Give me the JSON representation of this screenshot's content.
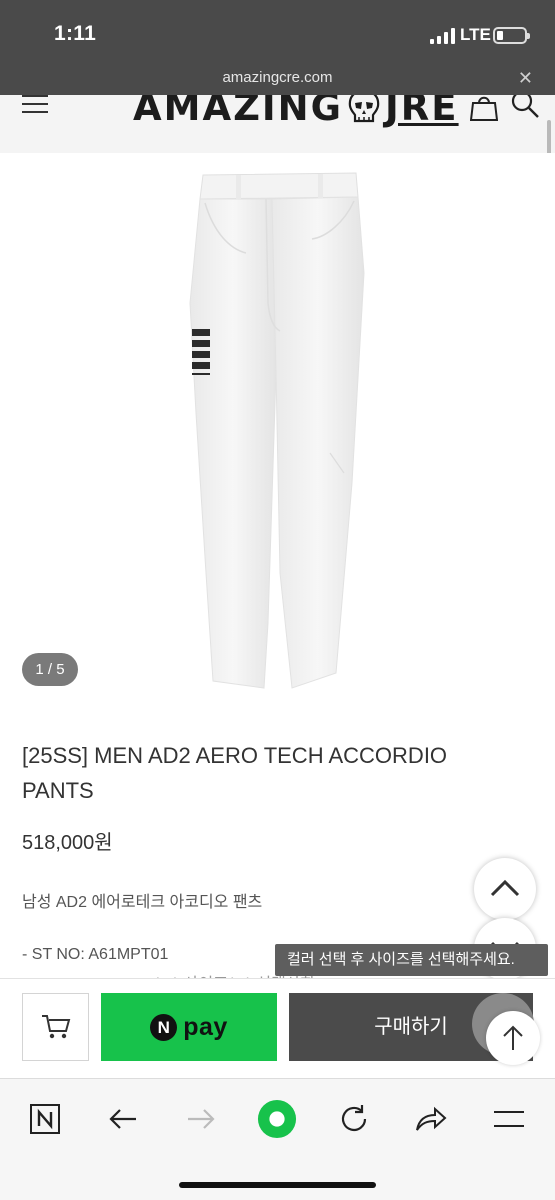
{
  "status_bar": {
    "time": "1:11",
    "network": "LTE",
    "signal_bars": 4
  },
  "browser": {
    "url": "amazingcre.com",
    "close_label": "✕"
  },
  "site_header": {
    "logo_left": "AMAZING",
    "logo_right": "JRE",
    "menu_icon": "hamburger-icon",
    "bag_icon": "shopping-bag-icon",
    "search_icon": "search-icon"
  },
  "gallery": {
    "counter": "1 / 5",
    "current": 1,
    "total": 5
  },
  "product": {
    "title": "[25SS] MEN AD2 AERO TECH ACCORDIO PANTS",
    "price": "518,000원",
    "korean_name": "남성 AD2 에어로테크 아코디오 팬츠",
    "style_no": "- ST NO: A61MPT01",
    "cut_line": "- COLOR : WHITE(W)  사이즈(M) 선택사항"
  },
  "tooltip": {
    "text": "컬러 선택 후 사이즈를 선택해주세요."
  },
  "purchase_bar": {
    "cart_icon": "cart-icon",
    "npay_n": "N",
    "npay_label": "pay",
    "buy_label": "구매하기"
  },
  "colors": {
    "status_bg": "#4a4a4a",
    "npay_green": "#17c24b",
    "buy_bg": "#4b4b4b",
    "toolbar_active": "#17c24b"
  },
  "toolbar": {
    "items": [
      "naver-n-icon",
      "back-arrow-icon",
      "forward-arrow-icon",
      "green-home-icon",
      "refresh-icon",
      "share-icon",
      "menu-icon"
    ]
  }
}
